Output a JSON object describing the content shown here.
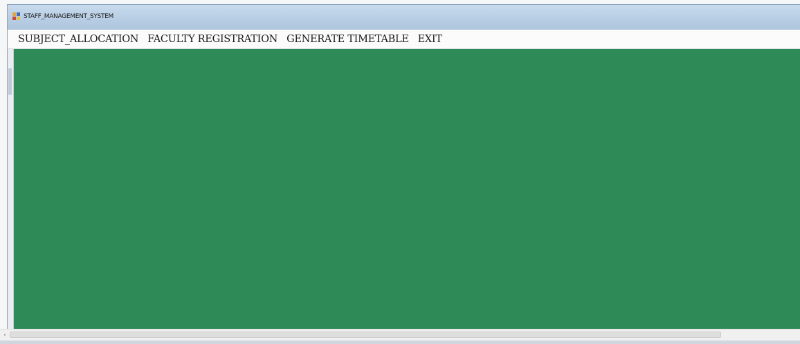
{
  "window": {
    "title": "STAFF_MANAGEMENT_SYSTEM",
    "icon": "app-form-icon",
    "client_background": "#2E8B57"
  },
  "menu": {
    "items": [
      {
        "label": "SUBJECT_ALLOCATION"
      },
      {
        "label": "FACULTY REGISTRATION"
      },
      {
        "label": "GENERATE TIMETABLE"
      },
      {
        "label": "EXIT"
      }
    ]
  },
  "scrollbar": {
    "left_arrow": "scroll-left-arrow-icon",
    "left_arrow_glyph": "‹"
  }
}
